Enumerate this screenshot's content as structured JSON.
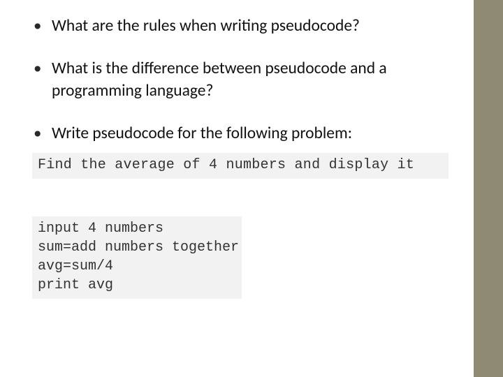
{
  "bullets": [
    "What are the rules when writing pseudocode?",
    "What is the difference between pseudocode and a programming language?",
    "Write pseudocode for the following problem:"
  ],
  "problem_text": "Find the average of 4 numbers and display it",
  "solution_text": "input 4 numbers\nsum=add numbers together\navg=sum/4\nprint avg"
}
